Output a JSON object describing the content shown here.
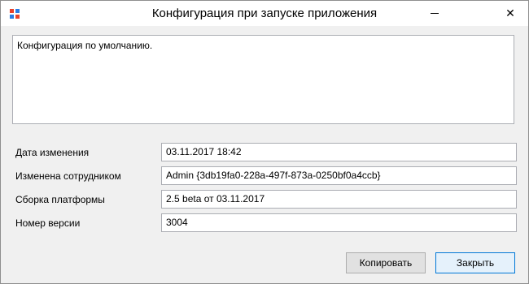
{
  "window": {
    "title": "Конфигурация при запуске приложения",
    "close_glyph": "✕"
  },
  "description": "Конфигурация по умолчанию.",
  "fields": [
    {
      "label": "Дата изменения",
      "value": "03.11.2017 18:42"
    },
    {
      "label": "Изменена сотрудником",
      "value": "Admin  {3db19fa0-228a-497f-873a-0250bf0a4ccb}"
    },
    {
      "label": "Сборка платформы",
      "value": "2.5 beta от 03.11.2017"
    },
    {
      "label": "Номер версии",
      "value": "3004"
    }
  ],
  "buttons": {
    "copy": "Копировать",
    "close": "Закрыть"
  },
  "colors": {
    "accent": "#0078d7",
    "icon_red": "#e8412c",
    "icon_blue": "#2b7be4"
  }
}
